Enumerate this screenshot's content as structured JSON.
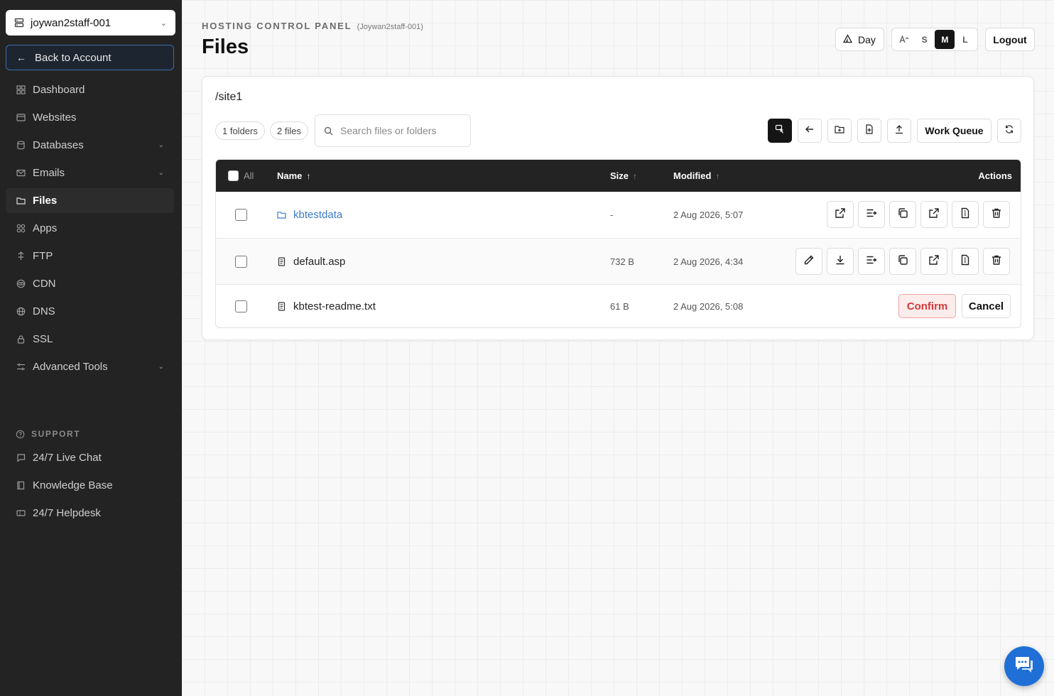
{
  "colors": {
    "sidebar_bg": "#232323",
    "accent_blue": "#3a7bc8",
    "danger": "#d33a3a",
    "chat_blue": "#1f6fd6"
  },
  "sidebar": {
    "account": {
      "value": "joywan2staff-001",
      "icon": "server-icon"
    },
    "back_label": "Back to Account",
    "items": [
      {
        "label": "Dashboard",
        "icon": "grid-icon",
        "expandable": false,
        "active": false
      },
      {
        "label": "Websites",
        "icon": "browser-icon",
        "expandable": false,
        "active": false
      },
      {
        "label": "Databases",
        "icon": "database-icon",
        "expandable": true,
        "active": false
      },
      {
        "label": "Emails",
        "icon": "mail-icon",
        "expandable": true,
        "active": false
      },
      {
        "label": "Files",
        "icon": "folder-icon",
        "expandable": false,
        "active": true
      },
      {
        "label": "Apps",
        "icon": "apps-icon",
        "expandable": false,
        "active": false
      },
      {
        "label": "FTP",
        "icon": "ftp-icon",
        "expandable": false,
        "active": false
      },
      {
        "label": "CDN",
        "icon": "cdn-icon",
        "expandable": false,
        "active": false
      },
      {
        "label": "DNS",
        "icon": "globe-icon",
        "expandable": false,
        "active": false
      },
      {
        "label": "SSL",
        "icon": "lock-icon",
        "expandable": false,
        "active": false
      },
      {
        "label": "Advanced Tools",
        "icon": "sliders-icon",
        "expandable": true,
        "active": false
      }
    ],
    "support_heading": "SUPPORT",
    "support_items": [
      {
        "label": "24/7 Live Chat",
        "icon": "chat-icon"
      },
      {
        "label": "Knowledge Base",
        "icon": "book-icon"
      },
      {
        "label": "24/7 Helpdesk",
        "icon": "ticket-icon"
      }
    ]
  },
  "header": {
    "eyebrow": "HOSTING CONTROL PANEL",
    "eyebrow_sub": "(Joywan2staff-001)",
    "title": "Files",
    "day_label": "Day",
    "text_sizes": [
      "S",
      "M",
      "L"
    ],
    "text_size_selected": "M",
    "logout_label": "Logout"
  },
  "files": {
    "path": "/site1",
    "folder_count": "1 folders",
    "file_count": "2 files",
    "search_placeholder": "Search files or folders",
    "work_queue_label": "Work Queue",
    "columns": {
      "all": "All",
      "name": "Name",
      "size": "Size",
      "modified": "Modified",
      "actions": "Actions"
    },
    "rows": [
      {
        "name": "kbtestdata",
        "type": "folder",
        "size": "-",
        "modified": "2 Aug 2026, 5:07"
      },
      {
        "name": "default.asp",
        "type": "file",
        "size": "732 B",
        "modified": "2 Aug 2026, 4:34"
      },
      {
        "name": "kbtest-readme.txt",
        "type": "file",
        "size": "61 B",
        "modified": "2 Aug 2026, 5:08"
      }
    ],
    "confirm_label": "Confirm",
    "cancel_label": "Cancel"
  }
}
